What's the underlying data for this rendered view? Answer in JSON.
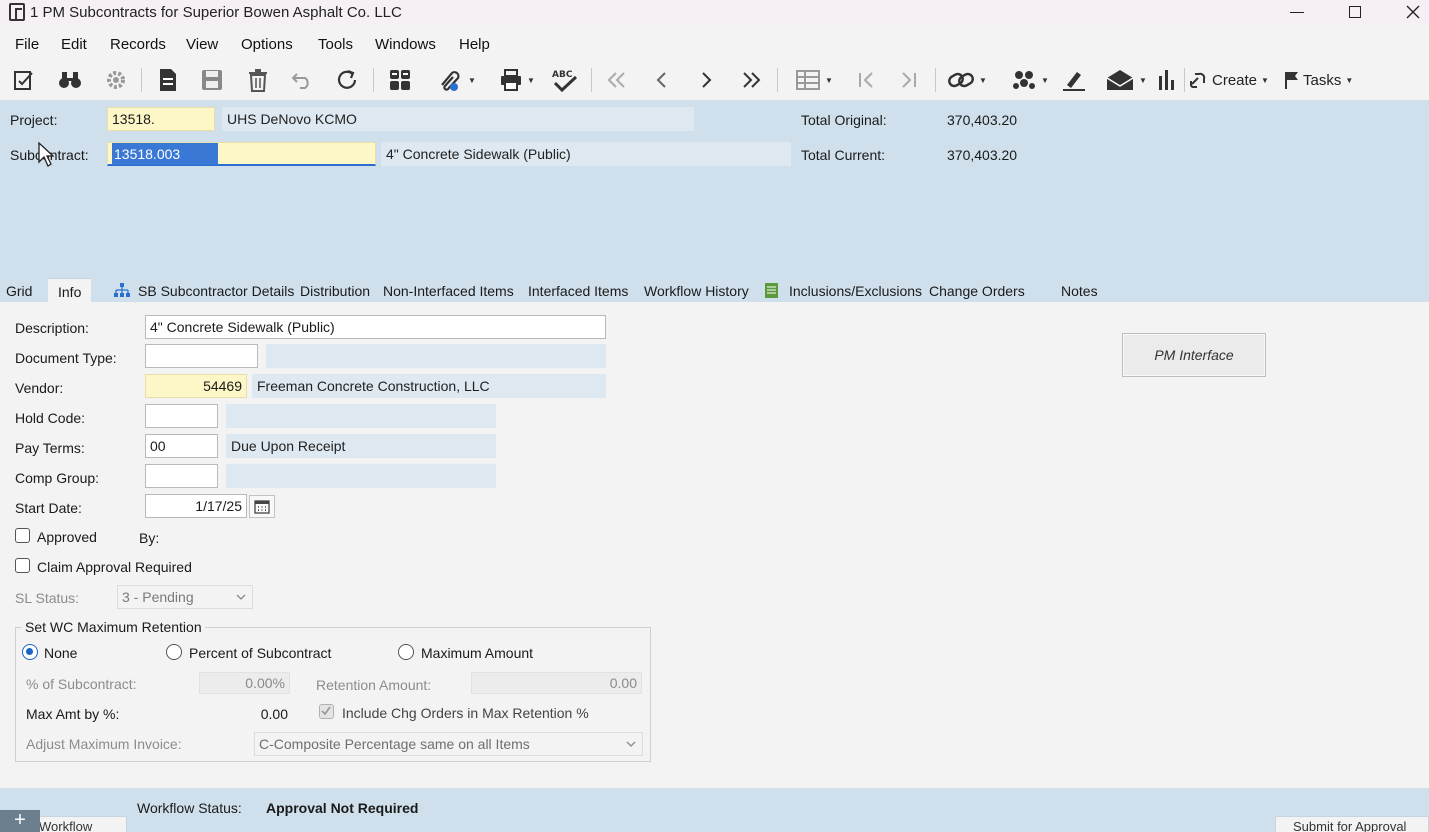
{
  "window": {
    "title": "1 PM Subcontracts for Superior Bowen  Asphalt Co. LLC"
  },
  "menu": [
    "File",
    "Edit",
    "Records",
    "View",
    "Options",
    "Tools",
    "Windows",
    "Help"
  ],
  "toolbar": {
    "create_label": "Create",
    "tasks_label": "Tasks"
  },
  "header": {
    "project_label": "Project:",
    "project_value": "13518.",
    "project_desc": "UHS DeNovo KCMO",
    "subcontract_label": "Subcontract:",
    "subcontract_value": "13518.003",
    "subcontract_desc": "4\" Concrete Sidewalk (Public)",
    "total_original_label": "Total Original:",
    "total_original_value": "370,403.20",
    "total_current_label": "Total Current:",
    "total_current_value": "370,403.20"
  },
  "tabs": [
    {
      "label": "Grid"
    },
    {
      "label": "Info"
    },
    {
      "label": "SB Subcontractor Details"
    },
    {
      "label": "Distribution"
    },
    {
      "label": "Non-Interfaced Items"
    },
    {
      "label": "Interfaced Items"
    },
    {
      "label": "Workflow History"
    },
    {
      "label": "Inclusions/Exclusions"
    },
    {
      "label": "Change Orders"
    },
    {
      "label": "Notes"
    }
  ],
  "info": {
    "description_label": "Description:",
    "description_value": "4\" Concrete Sidewalk (Public)",
    "doc_type_label": "Document Type:",
    "vendor_label": "Vendor:",
    "vendor_value": "54469",
    "vendor_name": "Freeman Concrete Construction, LLC",
    "hold_code_label": "Hold Code:",
    "pay_terms_label": "Pay Terms:",
    "pay_terms_value": "00",
    "pay_terms_desc": "Due Upon Receipt",
    "comp_group_label": "Comp Group:",
    "start_date_label": "Start Date:",
    "start_date_value": "1/17/25",
    "approved_label": "Approved",
    "by_label": "By:",
    "claim_approval_label": "Claim Approval Required",
    "sl_status_label": "SL Status:",
    "sl_status_value": "3 - Pending",
    "pm_interface_label": "PM Interface"
  },
  "retention": {
    "group_title": "Set WC Maximum Retention",
    "opt_none": "None",
    "opt_percent": "Percent of Subcontract",
    "opt_max": "Maximum Amount",
    "selected": "None",
    "pct_label": "% of Subcontract:",
    "pct_value": "0.00%",
    "ret_amount_label": "Retention Amount:",
    "ret_amount_value": "0.00",
    "max_amt_label": "Max Amt by %:",
    "max_amt_value": "0.00",
    "include_chg_label": "Include Chg Orders in Max Retention %",
    "adjust_label": "Adjust Maximum Invoice:",
    "adjust_value": "C-Composite Percentage same on all Items"
  },
  "status": {
    "workflow_status_label": "Workflow Status:",
    "workflow_status_value": "Approval Not Required",
    "workflow_tab": "Workflow",
    "submit_label": "Submit for Approval",
    "plus": "+"
  },
  "cursor": {
    "icon": "mouse-pointer-icon"
  }
}
